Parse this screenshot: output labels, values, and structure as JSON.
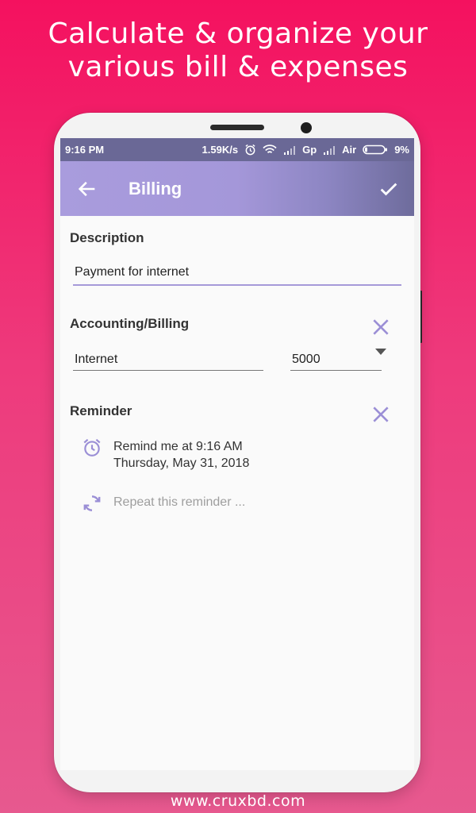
{
  "promo": {
    "headline_line1": "Calculate & organize your",
    "headline_line2": "various bill & expenses",
    "footer": "www.cruxbd.com"
  },
  "statusbar": {
    "time": "9:16 PM",
    "speed": "1.59K/s",
    "carrier1": "Gp",
    "carrier2": "Air",
    "battery": "9%"
  },
  "appbar": {
    "title": "Billing"
  },
  "description": {
    "label": "Description",
    "value": "Payment for internet"
  },
  "accounting": {
    "label": "Accounting/Billing",
    "category": "Internet",
    "amount": "5000"
  },
  "reminder": {
    "label": "Reminder",
    "time_line": "Remind me at 9:16 AM",
    "date_line": "Thursday, May 31, 2018",
    "repeat": "Repeat this reminder ..."
  },
  "colors": {
    "accent": "#9b8fd6",
    "statusbar": "#6a6896",
    "background_top": "#f4115f"
  }
}
